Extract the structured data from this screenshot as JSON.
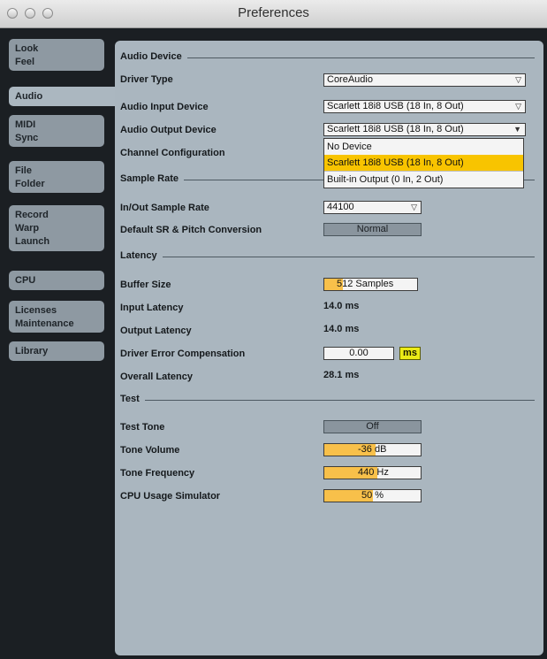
{
  "window": {
    "title": "Preferences"
  },
  "sidebar": {
    "tabs": [
      {
        "lines": [
          "Look",
          "Feel"
        ],
        "active": false
      },
      {
        "lines": [
          "Audio"
        ],
        "active": true
      },
      {
        "lines": [
          "MIDI",
          "Sync"
        ],
        "active": false
      },
      {
        "lines": [
          "File",
          "Folder"
        ],
        "active": false
      },
      {
        "lines": [
          "Record",
          "Warp",
          "Launch"
        ],
        "active": false
      },
      {
        "lines": [
          "CPU"
        ],
        "active": false
      },
      {
        "lines": [
          "Licenses",
          "Maintenance"
        ],
        "active": false
      },
      {
        "lines": [
          "Library"
        ],
        "active": false
      }
    ]
  },
  "audio_device": {
    "heading": "Audio Device",
    "driver_type_label": "Driver Type",
    "driver_type_value": "CoreAudio",
    "input_label": "Audio Input Device",
    "input_value": "Scarlett 18i8 USB (18 In, 8 Out)",
    "output_label": "Audio Output Device",
    "output_value": "Scarlett 18i8 USB (18 In, 8 Out)",
    "channel_config_label": "Channel Configuration",
    "output_options": [
      "No Device",
      "Scarlett 18i8 USB (18 In, 8 Out)",
      "Built-in Output (0 In, 2 Out)"
    ],
    "output_selected_index": 1
  },
  "sample_rate": {
    "heading": "Sample Rate",
    "inout_label": "In/Out Sample Rate",
    "inout_value": "44100",
    "default_sr_label": "Default SR & Pitch Conversion",
    "default_sr_value": "Normal"
  },
  "latency": {
    "heading": "Latency",
    "buffer_label": "Buffer Size",
    "buffer_value_highlight": "512",
    "buffer_value_rest": " Samples",
    "input_latency_label": "Input Latency",
    "input_latency_value": "14.0 ms",
    "output_latency_label": "Output Latency",
    "output_latency_value": "14.0 ms",
    "driver_comp_label": "Driver Error Compensation",
    "driver_comp_value": "0.00",
    "driver_comp_unit": "ms",
    "overall_label": "Overall Latency",
    "overall_value": "28.1 ms"
  },
  "test": {
    "heading": "Test",
    "tone_label": "Test Tone",
    "tone_value": "Off",
    "volume_label": "Tone Volume",
    "volume_value": "-36",
    "volume_unit": " dB",
    "frequency_label": "Tone Frequency",
    "frequency_value": "440",
    "frequency_unit": " Hz",
    "cpu_sim_label": "CPU Usage Simulator",
    "cpu_sim_value": "50 %",
    "cpu_sim_level": 0.5
  },
  "colors": {
    "accent": "#f8c04a",
    "selected": "#f8c400",
    "panel": "#aab6bf",
    "tab": "#8e99a2"
  }
}
